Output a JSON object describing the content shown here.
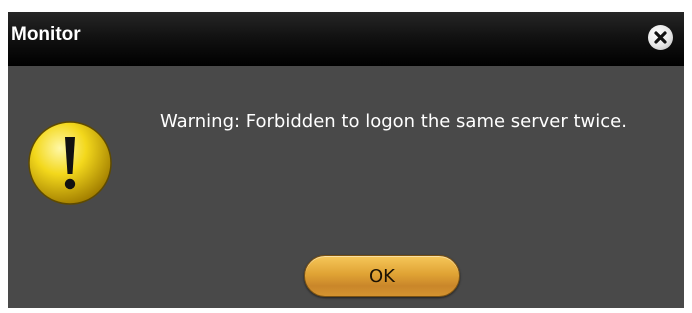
{
  "dialog": {
    "title": "Monitor",
    "close_icon": "close-icon",
    "warning_icon": "warning-icon",
    "message": "Warning: Forbidden to logon the same server twice.",
    "ok_label": "OK"
  },
  "colors": {
    "dialog_background": "#494949",
    "titlebar": "#000000",
    "title_text": "#ffffff",
    "message_text": "#ffffff",
    "ok_button": "#e0a334",
    "warning_icon": "#f2d21a"
  }
}
